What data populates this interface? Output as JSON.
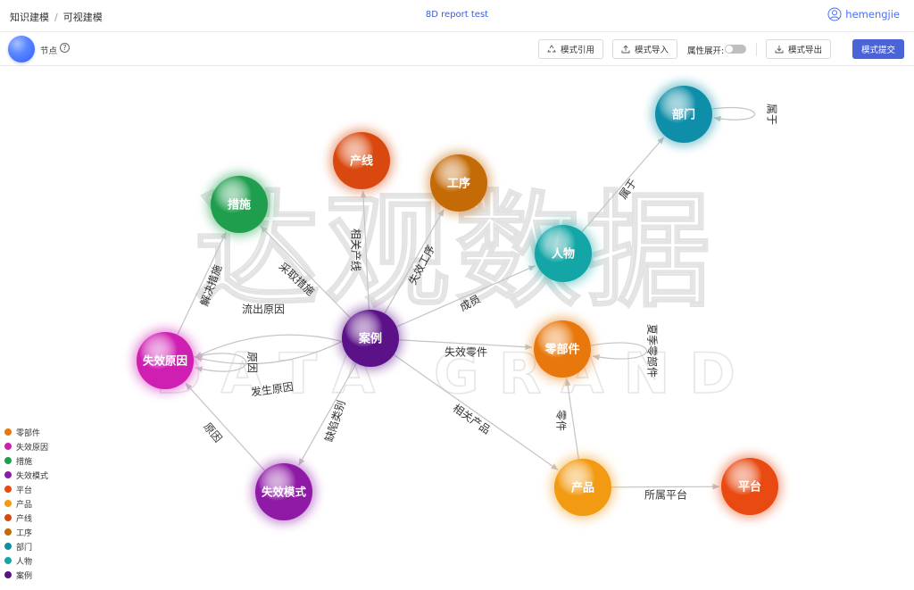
{
  "breadcrumb": {
    "root": "知识建模",
    "sep": "/",
    "current": "可视建模"
  },
  "doc_title": "8D report test",
  "user": {
    "name": "hemengjie",
    "icon": "user-avatar-icon"
  },
  "toolbar": {
    "node_label": "节点",
    "help_icon": "?",
    "ref_label": "模式引用",
    "import_label": "模式导入",
    "expand_label": "属性展开:",
    "expand_on": false,
    "export_label": "模式导出",
    "submit_label": "模式提交"
  },
  "watermark": {
    "main": "达观数据",
    "sub": "DATA GRAND"
  },
  "colors": {
    "accent": "#4a64d8",
    "link": "#3b5bdb"
  },
  "graph": {
    "nodes": [
      {
        "id": "dept",
        "label": "部门",
        "color": "#0e8ea8"
      },
      {
        "id": "line",
        "label": "产线",
        "color": "#d9480f"
      },
      {
        "id": "proc",
        "label": "工序",
        "color": "#c46b08"
      },
      {
        "id": "meas",
        "label": "措施",
        "color": "#1f9e4e"
      },
      {
        "id": "person",
        "label": "人物",
        "color": "#14a6a6"
      },
      {
        "id": "case",
        "label": "案例",
        "color": "#5b1288"
      },
      {
        "id": "cause",
        "label": "失效原因",
        "color": "#cf1fb3"
      },
      {
        "id": "part",
        "label": "零部件",
        "color": "#e8780c"
      },
      {
        "id": "mode",
        "label": "失效模式",
        "color": "#8e1aa6"
      },
      {
        "id": "prod",
        "label": "产品",
        "color": "#f29a12"
      },
      {
        "id": "plat",
        "label": "平台",
        "color": "#e84a12"
      }
    ],
    "edges": [
      {
        "id": "e1",
        "label": "属于"
      },
      {
        "id": "e2",
        "label": "属于"
      },
      {
        "id": "e3",
        "label": "相关产线"
      },
      {
        "id": "e4",
        "label": "失效工序"
      },
      {
        "id": "e5",
        "label": "采取措施"
      },
      {
        "id": "e6",
        "label": "成员"
      },
      {
        "id": "e7",
        "label": "解决措施"
      },
      {
        "id": "e8",
        "label": "流出原因"
      },
      {
        "id": "e9",
        "label": "原因"
      },
      {
        "id": "e10",
        "label": "发生原因"
      },
      {
        "id": "e11",
        "label": "失效零件"
      },
      {
        "id": "e12",
        "label": "夏季零部件"
      },
      {
        "id": "e13",
        "label": "缺陷类别"
      },
      {
        "id": "e14",
        "label": "原因"
      },
      {
        "id": "e15",
        "label": "相关产品"
      },
      {
        "id": "e16",
        "label": "零件"
      },
      {
        "id": "e17",
        "label": "所属平台"
      }
    ]
  },
  "legend": [
    {
      "label": "零部件",
      "color": "#e8780c"
    },
    {
      "label": "失效原因",
      "color": "#cf1fb3"
    },
    {
      "label": "措施",
      "color": "#1f9e4e"
    },
    {
      "label": "失效模式",
      "color": "#8e1aa6"
    },
    {
      "label": "平台",
      "color": "#e84a12"
    },
    {
      "label": "产品",
      "color": "#f29a12"
    },
    {
      "label": "产线",
      "color": "#d9480f"
    },
    {
      "label": "工序",
      "color": "#c46b08"
    },
    {
      "label": "部门",
      "color": "#0e8ea8"
    },
    {
      "label": "人物",
      "color": "#14a6a6"
    },
    {
      "label": "案例",
      "color": "#5b1288"
    }
  ]
}
